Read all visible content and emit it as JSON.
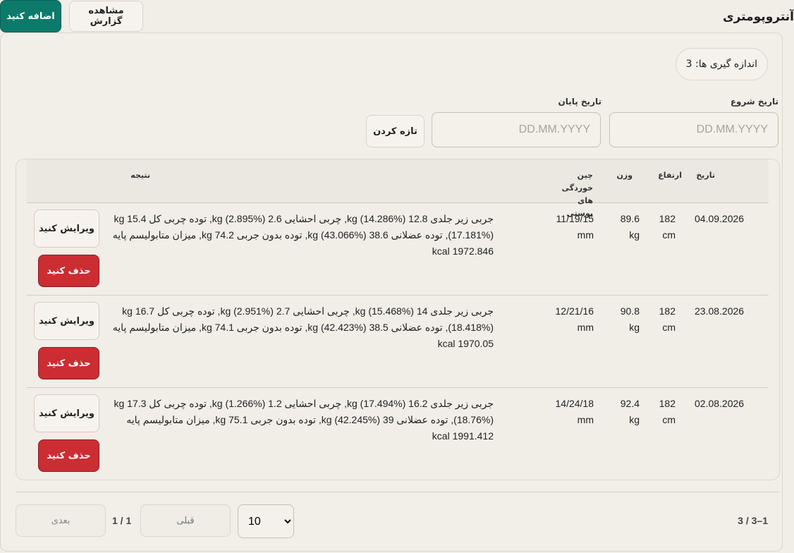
{
  "header": {
    "title": "آنتروپومتری",
    "add_label": "اضافه کنید",
    "report_label": "مشاهده گزارش"
  },
  "summary": {
    "count_text": "اندازه گیری ها: 3"
  },
  "filters": {
    "start_label": "تاریخ شروع",
    "end_label": "تاریخ پایان",
    "placeholder": "DD.MM.YYYY",
    "refresh_label": "تازه کردن"
  },
  "table": {
    "headers": {
      "date": "تاریخ",
      "height": "ارتفاع",
      "weight": "وزن",
      "skinfolds": "چین خوردگی های پوستی",
      "result": "نتیجه"
    },
    "rows": [
      {
        "date": "04.09.2026",
        "height": "182 cm",
        "weight": "89.6 kg",
        "skinfolds": "11/19/15 mm",
        "result_line1": "جربی زیر جلدی 12.8 kg (14.286%), چربی احشایی 2.6 kg (2.895%), توده چربی کل 15.4 kg",
        "result_line2": "(17.181%), توده عضلانی 38.6 kg (43.066%), توده بدون جربی 74.2 kg, میزان متابولیسم پایه 1972.846 kcal",
        "edit_label": "ویرایش کنید",
        "delete_label": "حذف کنید"
      },
      {
        "date": "23.08.2026",
        "height": "182 cm",
        "weight": "90.8 kg",
        "skinfolds": "12/21/16 mm",
        "result_line1": "جربی زیر جلدی 14 kg (15.468%), چربی احشایی 2.7 kg (2.951%), توده چربی کل 16.7 kg",
        "result_line2": "(18.418%), توده عضلانی 38.5 kg (42.423%), توده بدون جربی 74.1 kg, میزان متابولیسم پایه 1970.05 kcal",
        "edit_label": "ویرایش کنید",
        "delete_label": "حذف کنید"
      },
      {
        "date": "02.08.2026",
        "height": "182 cm",
        "weight": "92.4 kg",
        "skinfolds": "14/24/18 mm",
        "result_line1": "جربی زیر جلدی 16.2 kg (17.494%), چربی احشایی 1.2 kg (1.266%), توده چربی کل 17.3 kg",
        "result_line2": "(18.76%), توده عضلانی 39 kg (42.245%), توده بدون جربی 75.1 kg, میزان متابولیسم پایه 1991.412 kcal",
        "edit_label": "ویرایش کنید",
        "delete_label": "حذف کنید"
      }
    ]
  },
  "pagination": {
    "range_text": "1–3 / 3",
    "page_size": "10",
    "prev_label": "قبلی",
    "page_text": "1 / 1",
    "next_label": "بعدی"
  }
}
